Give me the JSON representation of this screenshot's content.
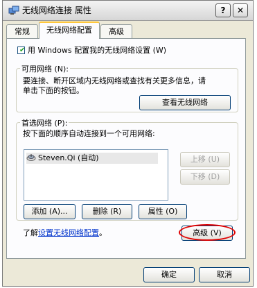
{
  "window": {
    "title": "无线网络连接 属性",
    "help_label": "?",
    "close_label": "✕"
  },
  "tabs": [
    {
      "label": "常规",
      "selected": false
    },
    {
      "label": "无线网络配置",
      "selected": true
    },
    {
      "label": "高级",
      "selected": false
    }
  ],
  "wireless_config": {
    "checkbox_label": "用 Windows 配置我的无线网络设置 (W)",
    "checkbox_checked": true
  },
  "available_networks": {
    "group_label": "可用网络 (N):",
    "description_line1": "要连接、断开区域内无线网络或查找有关更多信息，请",
    "description_line2": "单击下面的按钮。",
    "view_button": "查看无线网络"
  },
  "preferred_networks": {
    "group_label": "首选网络 (P):",
    "instruction": "按下面的顺序自动连接到一个可用网络:",
    "items": [
      {
        "label": "Steven.Qi (自动)",
        "icon": "wireless-network-icon"
      }
    ],
    "move_up_button": "上移 (U)",
    "move_down_button": "下移 (D)",
    "add_button": "添加 (A)...",
    "remove_button": "删除 (R)",
    "properties_button": "属性 (O)"
  },
  "learn_more": {
    "prefix": "了解",
    "link": "设置无线网络配置",
    "suffix": "。"
  },
  "advanced_button": "高级 (V)",
  "footer": {
    "ok_button": "确定",
    "cancel_button": "取消"
  },
  "colors": {
    "dialog_bg": "#ece9d8",
    "panel_bg": "#fcfcfe",
    "link": "#0033cc",
    "highlight": "#e00000"
  }
}
